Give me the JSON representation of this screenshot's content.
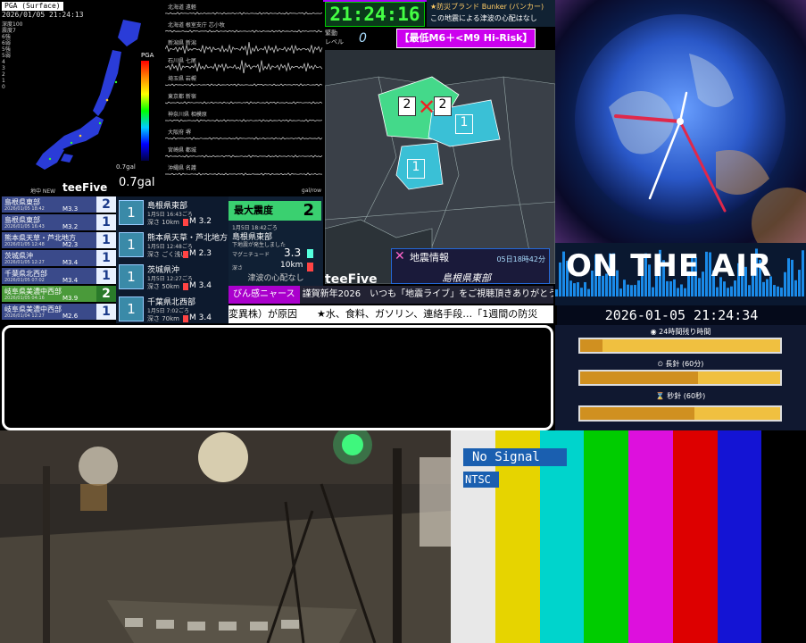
{
  "pga": {
    "header": "PGA (Surface)",
    "timestamp": "2026/01/05 21:24:13",
    "legend_lines": [
      "深度100",
      "震度7",
      "6強",
      "6弱",
      "5強",
      "5弱",
      "4",
      "3",
      "2",
      "1",
      "0"
    ],
    "scale_top_label": "PGA",
    "scale_bottom_label": "0.7gal",
    "current_value": "0.7gal",
    "footer_left": "地中 NEW",
    "brand": "teeFive"
  },
  "waveforms": {
    "stations": [
      "北海道 遠軽",
      "北海道 根室支庁 芯小牧",
      "新潟県 新潟",
      "石川県 七尾",
      "埼玉県 岩槻",
      "東京都 新宿",
      "神奈川県 相模原",
      "大阪府 堺",
      "宮崎県 都城",
      "沖縄県 名護"
    ],
    "unit": "gal/row"
  },
  "clock": {
    "time": "21:24:16",
    "bunker_line1": "★防災ブランド Bunker (バンカー)",
    "bunker_line2": "この地震による津波の心配はなし"
  },
  "shindo_level": {
    "label_top": "緊動",
    "label_bottom": "レベル",
    "value": "0"
  },
  "risk_banner": "【最低M6＋<M9 Hi-Risk】",
  "eq_info": {
    "title": "地震情報",
    "datetime": "05日18時42分",
    "place": "島根県東部",
    "brand": "teeFive"
  },
  "quake_list": [
    {
      "name": "島根県東部",
      "date": "2026/01/05 18:42",
      "mag": "M3.3",
      "shindo": "2",
      "highlight": false
    },
    {
      "name": "島根県東部",
      "date": "2026/01/05 16:43",
      "mag": "M3.2",
      "shindo": "1",
      "highlight": false
    },
    {
      "name": "熊本県天草・芦北地方",
      "date": "2026/01/05 12:48",
      "mag": "M2.3",
      "shindo": "1",
      "highlight": false
    },
    {
      "name": "茨城県沖",
      "date": "2026/01/05 12:27",
      "mag": "M3.4",
      "shindo": "1",
      "highlight": false
    },
    {
      "name": "千葉県北西部",
      "date": "2026/01/05 07:02",
      "mag": "M3.4",
      "shindo": "1",
      "highlight": false
    },
    {
      "name": "岐阜県美濃中西部",
      "date": "2026/01/05 04:16",
      "mag": "M3.9",
      "shindo": "2",
      "highlight": true
    },
    {
      "name": "岐阜県美濃中西部",
      "date": "2026/01/04 12:27",
      "mag": "M2.6",
      "shindo": "1",
      "highlight": false
    }
  ],
  "detail_list": [
    {
      "shindo": "1",
      "name": "島根県東部",
      "time": "1月5日 16:43ごろ",
      "depth": "深さ 10km",
      "mag": "M 3.2"
    },
    {
      "shindo": "1",
      "name": "熊本県天草・芦北地方",
      "time": "1月5日 12:48ごろ",
      "depth": "深さ ごく浅い",
      "mag": "M 2.3"
    },
    {
      "shindo": "1",
      "name": "茨城県沖",
      "time": "1月5日 12:27ごろ",
      "depth": "深さ 50km",
      "mag": "M 3.4"
    },
    {
      "shindo": "1",
      "name": "千葉県北西部",
      "time": "1月5日 7:02ごろ",
      "depth": "深さ 70km",
      "mag": "M 3.4"
    }
  ],
  "max_intensity": {
    "label": "最大震度",
    "value": "2",
    "time": "1月5日 18:42ごろ",
    "place": "島根県東部",
    "sub": "下地震が発生しました",
    "mag_label": "マグニチュード",
    "mag_value": "3.3",
    "depth_label": "深さ",
    "depth_value": "10km",
    "tsunami": "津波の心配なし"
  },
  "ticker1": {
    "label": "びん感ニャース",
    "text": "謹賀新年2026　いつも「地震ライブ」をご視聴頂きありがとうございます!"
  },
  "ticker2": "変異株）が原因　　★水、食料、ガソリン、連絡手段…「1週間の防災",
  "onair": {
    "title": "ON THE AIR",
    "datetime": "2026-01-05 21:24:34",
    "label_day": "24時間残り時間",
    "label_min": "長針 (60分)",
    "label_sec": "秒針 (60秒)",
    "progress_day": 0.11,
    "progress_min": 0.59,
    "progress_sec": 0.57
  },
  "test_pattern": {
    "no_signal": "No Signal",
    "format": "NTSC"
  },
  "colors": {
    "tp": [
      "#e8e8e8",
      "#e6d400",
      "#00d4cc",
      "#00cc00",
      "#dd10dd",
      "#dd0000",
      "#1414d4",
      "#000000"
    ]
  }
}
